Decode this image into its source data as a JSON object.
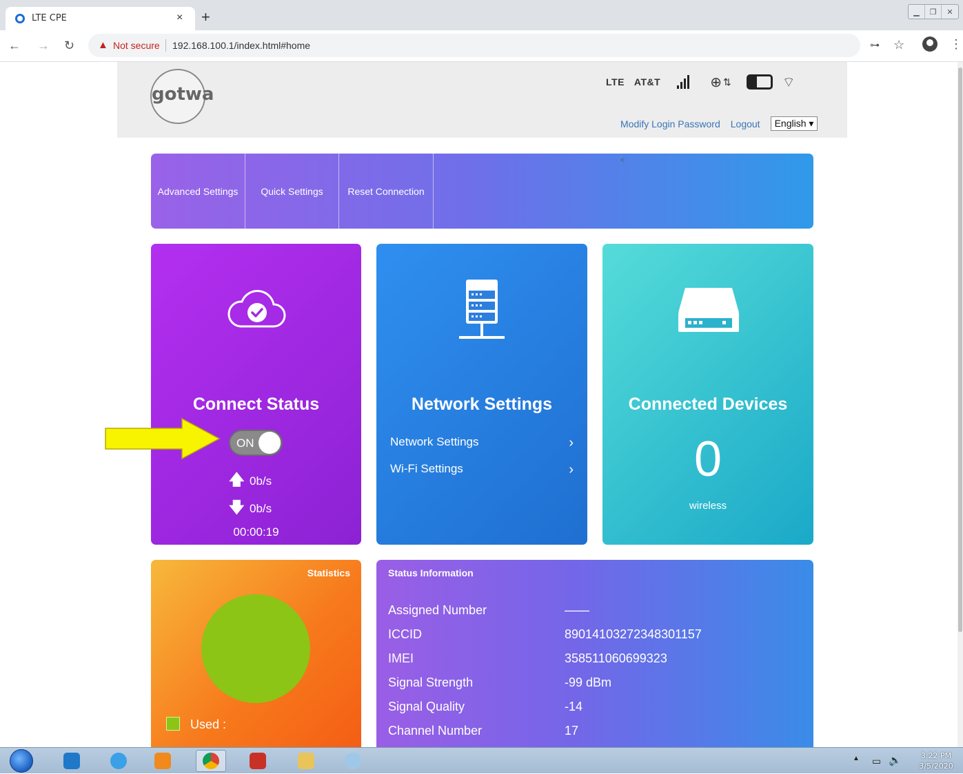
{
  "browser": {
    "tab_title": "LTE CPE",
    "tab_close": "×",
    "new_tab": "+",
    "security_label": "Not secure",
    "url": "192.168.100.1/index.html#home"
  },
  "header": {
    "logo_text": "gotwa",
    "network_type": "LTE",
    "carrier": "AT&T",
    "signal_bars": 4,
    "modify_password_link": "Modify Login Password",
    "logout_link": "Logout",
    "language": "English ▾"
  },
  "nav": {
    "items": [
      {
        "label": "Advanced Settings"
      },
      {
        "label": "Quick Settings"
      },
      {
        "label": "Reset Connection"
      }
    ],
    "caret": "<"
  },
  "connect_status": {
    "title": "Connect Status",
    "toggle_label": "ON",
    "toggle_on": true,
    "upload_rate": "0b/s",
    "download_rate": "0b/s",
    "elapsed": "00:00:19"
  },
  "network_settings": {
    "title": "Network Settings",
    "links": [
      {
        "label": "Network Settings"
      },
      {
        "label": "Wi-Fi Settings"
      }
    ]
  },
  "connected_devices": {
    "title": "Connected Devices",
    "count": "0",
    "label": "wireless"
  },
  "statistics": {
    "title": "Statistics",
    "legend_label": "Used :",
    "legend_color": "#8cc515"
  },
  "status_info": {
    "title": "Status Information",
    "rows": [
      {
        "label": "Assigned Number",
        "value": "——"
      },
      {
        "label": "ICCID",
        "value": "89014103272348301157"
      },
      {
        "label": "IMEI",
        "value": "358511060699323"
      },
      {
        "label": "Signal Strength",
        "value": "-99 dBm"
      },
      {
        "label": "Signal Quality",
        "value": "-14"
      },
      {
        "label": "Channel Number",
        "value": "17"
      }
    ]
  },
  "taskbar": {
    "clock_time": "3:22 PM",
    "clock_date": "3/5/2020"
  }
}
